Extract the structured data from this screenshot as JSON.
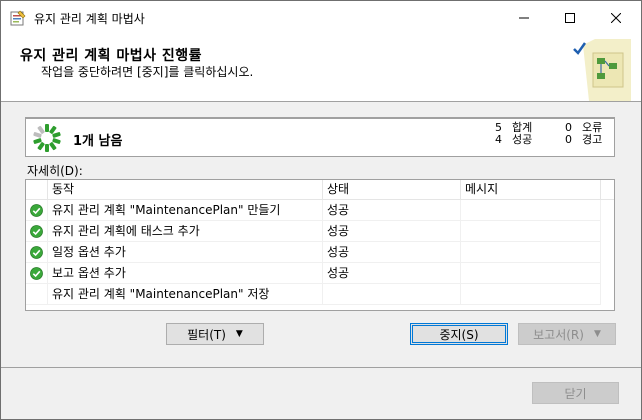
{
  "window": {
    "title": "유지 관리 계획 마법사",
    "icon": "wizard-app-icon"
  },
  "banner": {
    "title": "유지 관리 계획 마법사 진행률",
    "subtitle": "작업을 중단하려면 [중지]를 클릭하십시오."
  },
  "summary": {
    "remaining": "1개 남음",
    "total_count": "5",
    "total_label": "합계",
    "success_count": "4",
    "success_label": "성공",
    "error_count": "0",
    "error_label": "오류",
    "warning_count": "0",
    "warning_label": "경고"
  },
  "details_label": "자세히(D):",
  "grid": {
    "columns": [
      "동작",
      "상태",
      "메시지"
    ],
    "rows": [
      {
        "action": "유지 관리 계획 \"MaintenancePlan\" 만들기",
        "status": "성공",
        "message": "",
        "done": true
      },
      {
        "action": "유지 관리 계획에 태스크 추가",
        "status": "성공",
        "message": "",
        "done": true
      },
      {
        "action": "일정 옵션 추가",
        "status": "성공",
        "message": "",
        "done": true
      },
      {
        "action": "보고 옵션 추가",
        "status": "성공",
        "message": "",
        "done": true
      },
      {
        "action": "유지 관리 계획 \"MaintenancePlan\" 저장",
        "status": "",
        "message": "",
        "done": false
      }
    ]
  },
  "buttons": {
    "filter": "필터(T)",
    "stop": "중지(S)",
    "report": "보고서(R)",
    "close": "닫기"
  },
  "colors": {
    "success_green": "#3aa83a",
    "spinner_green": "#2e9e2e",
    "accent_blue": "#0078d7"
  }
}
